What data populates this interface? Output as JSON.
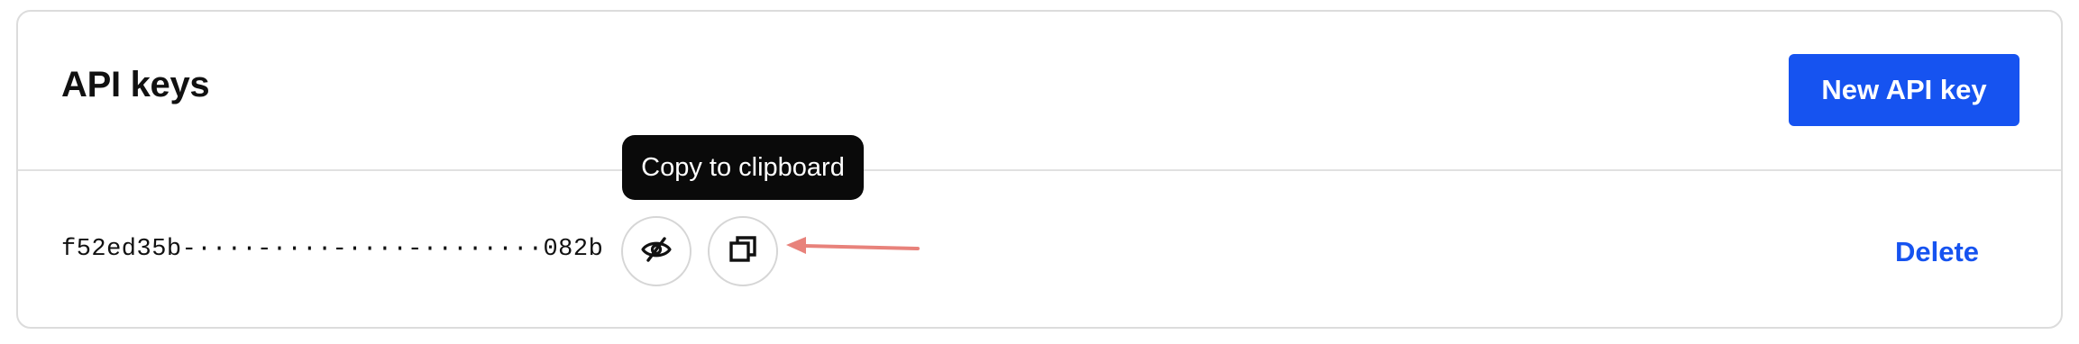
{
  "header": {
    "title": "API keys",
    "new_key_label": "New API key"
  },
  "keys": [
    {
      "masked_value": "f52ed35b-····-····-····-········082b",
      "toggle_icon": "eye-off-icon",
      "copy_icon": "copy-icon",
      "delete_label": "Delete"
    }
  ],
  "tooltip": {
    "text": "Copy to clipboard"
  },
  "annotation": {
    "arrow_color": "#e8827b"
  },
  "colors": {
    "accent": "#1653f0",
    "tooltip_bg": "#0a0a0a"
  }
}
